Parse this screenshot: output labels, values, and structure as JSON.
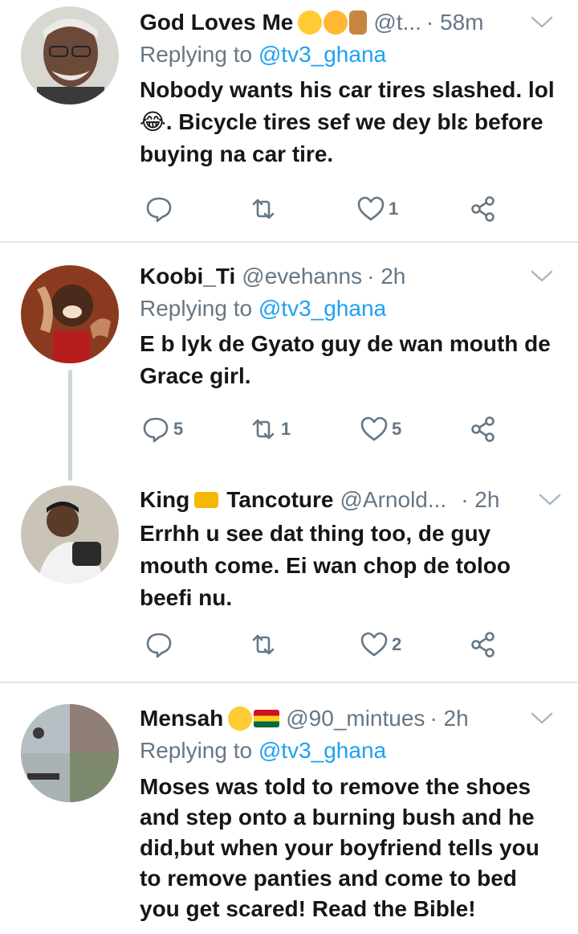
{
  "tweets": [
    {
      "name": "God Loves Me",
      "emoji_names": [
        "smiling-face-icon",
        "hugging-face-icon",
        "folded-hands-icon"
      ],
      "handle": "@t...",
      "time": "· 58m",
      "reply_prefix": "Replying to ",
      "reply_mention": "@tv3_ghana",
      "text": "Nobody wants his car tires slashed. lol\n😂. Bicycle tires sef we dey blɛ before\nbuying na car tire.",
      "reply_count": "",
      "retweet_count": "",
      "like_count": "1"
    },
    {
      "name": "Koobi_Ti",
      "handle": "@evehanns",
      "time": "· 2h",
      "reply_prefix": "Replying to ",
      "reply_mention": "@tv3_ghana",
      "text": "E b lyk de Gyato guy de wan mouth de\nGrace girl.",
      "reply_count": "5",
      "retweet_count": "1",
      "like_count": "5"
    },
    {
      "name": "King",
      "name_suffix": "Tancoture",
      "emoji_names": [
        "crown-icon"
      ],
      "handle": "@Arnold...",
      "time": "· 2h",
      "text": "Errhh u see dat thing too, de guy\nmouth come. Ei wan chop de toloo\nbeefi nu.",
      "reply_count": "",
      "retweet_count": "",
      "like_count": "2"
    },
    {
      "name": "Mensah",
      "emoji_names": [
        "sunglasses-face-icon",
        "ghana-flag-icon"
      ],
      "handle": "@90_mintues",
      "time": "· 2h",
      "reply_prefix": "Replying to ",
      "reply_mention": "@tv3_ghana",
      "text": "Moses was told to remove the shoes\nand step onto a burning bush and he\ndid,but when your boyfriend tells you\nto remove panties and come to bed\nyou get scared! Read the Bible!"
    }
  ],
  "colors": {
    "accent": "#1da1f2",
    "secondary": "#657786",
    "text": "#14171a",
    "divider": "#e1e8ed"
  }
}
